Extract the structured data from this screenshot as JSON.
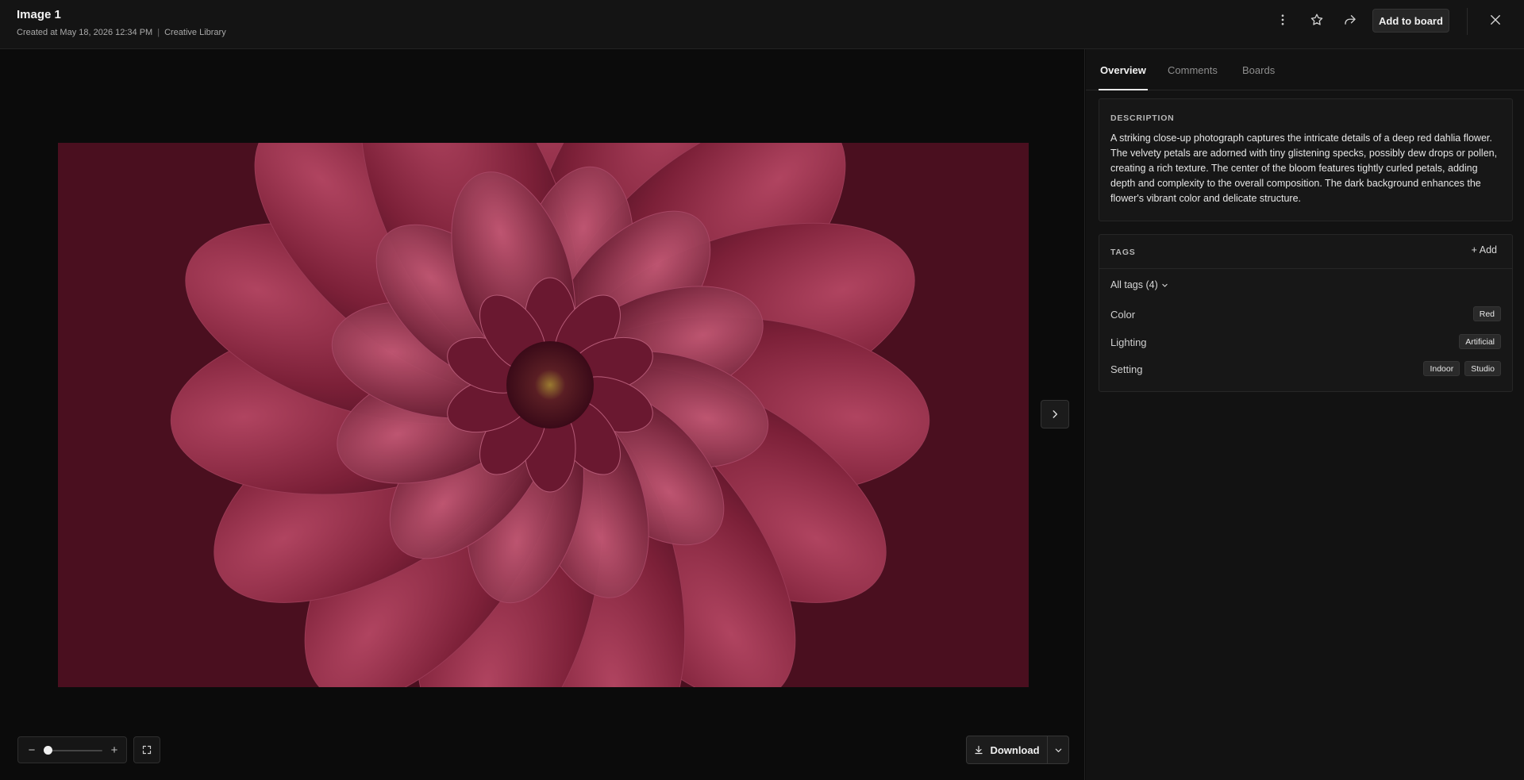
{
  "header": {
    "title": "Image 1",
    "created": "Created at May 18, 2026 12:34 PM",
    "separator": "|",
    "library": "Creative Library",
    "add_to_board": "Add to board",
    "icons": [
      "more-vertical-icon",
      "star-icon",
      "share-icon",
      "close-icon"
    ]
  },
  "viewer": {
    "zoom_minus": "−",
    "zoom_plus": "+",
    "zoom_level": 0,
    "download_label": "Download"
  },
  "panel": {
    "tabs": [
      {
        "label": "Overview",
        "active": true
      },
      {
        "label": "Comments",
        "active": false
      },
      {
        "label": "Boards",
        "active": false
      }
    ],
    "description": {
      "label": "DESCRIPTION",
      "text": "A striking close-up photograph captures the intricate details of a deep red dahlia flower. The velvety petals are adorned with tiny glistening specks, possibly dew drops or pollen, creating a rich texture. The center of the bloom features tightly curled petals, adding depth and complexity to the overall composition. The dark background enhances the flower's vibrant color and delicate structure."
    },
    "tags": {
      "label": "TAGS",
      "add_label": "+ Add",
      "all_tags_label": "All tags (4)",
      "rows": [
        {
          "name": "Color",
          "values": [
            "Red"
          ]
        },
        {
          "name": "Lighting",
          "values": [
            "Artificial"
          ]
        },
        {
          "name": "Setting",
          "values": [
            "Indoor",
            "Studio"
          ]
        }
      ]
    }
  },
  "colors": {
    "background": "#0b0b0b",
    "panel": "#121212",
    "flower_primary": "#7a2035"
  }
}
